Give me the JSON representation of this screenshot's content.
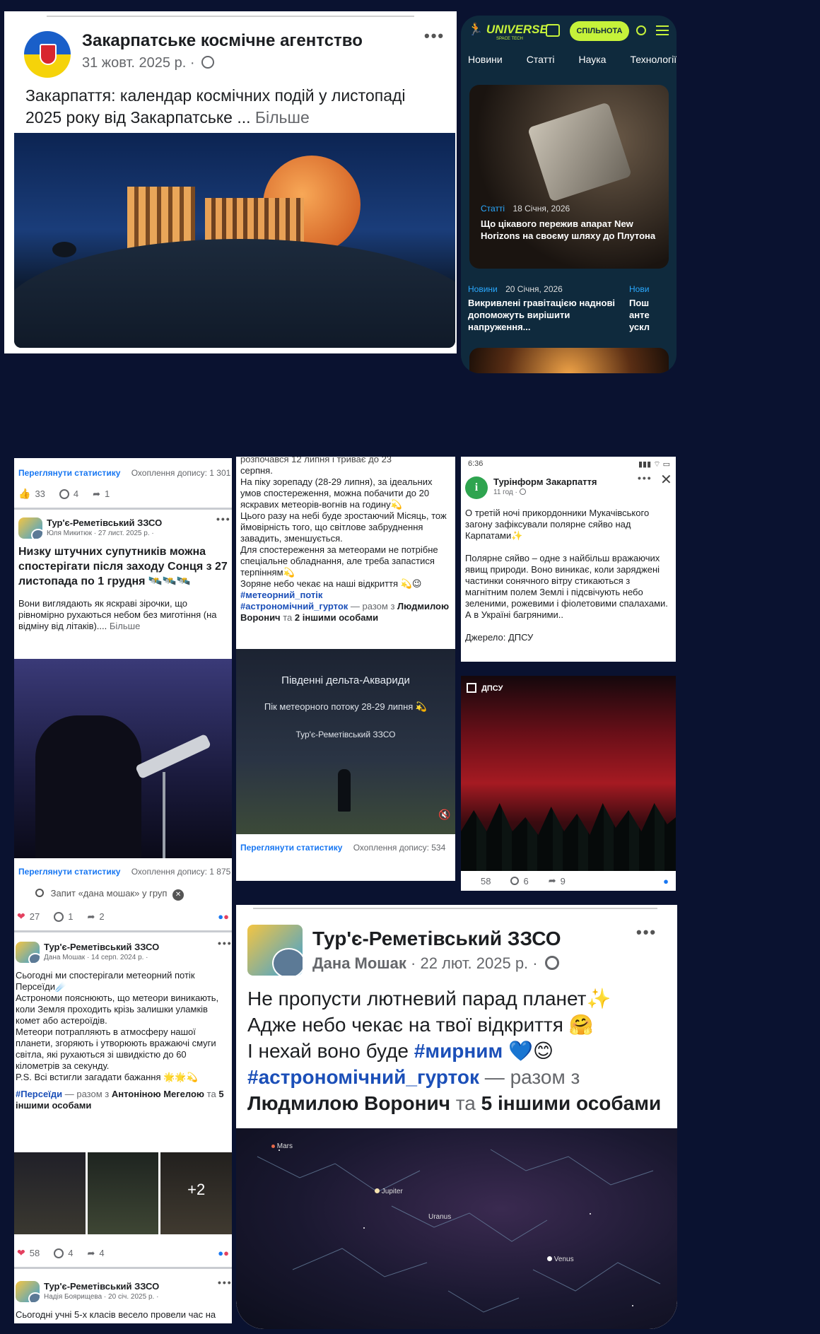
{
  "post1": {
    "page_name": "Закарпатське космічне агентство",
    "date": "31 жовт. 2025 р. ·",
    "text": "Закарпаття: календар космічних подій у листопаді 2025 року від Закарпатське ...",
    "more": "Більше",
    "menu": "•••"
  },
  "universe": {
    "logo": "UNIVERSE",
    "logo_sub": "SPACE TECH",
    "community_btn": "СПІЛЬНОТА",
    "nav": [
      "Новини",
      "Статті",
      "Наука",
      "Технології"
    ],
    "article1": {
      "category": "Статті",
      "date": "18 Січня, 2026",
      "title": "Що цікавого пережив апарат New Horizons на своєму шляху до Плутона"
    },
    "article2": {
      "category": "Новини",
      "date": "20 Січня, 2026",
      "title": "Викривлені гравітацією наднові допоможуть вирішити напруження..."
    },
    "article3": {
      "category": "Нови",
      "title": "Пош анте ускл"
    }
  },
  "post2": {
    "stats_link": "Переглянути статистику",
    "reach": "Охоплення допису: 1 301",
    "likes": "33",
    "comments": "4",
    "shares": "1",
    "page_name": "Тур'є-Реметівський ЗЗСО",
    "author_date": "Юля Микитюк · 27 лист. 2025 р. ·",
    "headline": "Низку штучних супутників можна спостерігати після заходу Сонця з 27 листопада по 1 грудня 🛰️🛰️🛰️",
    "body": "Вони виглядають як яскраві зірочки, що рівномірно рухаються небом без миготіння (на відміну від літаків)....",
    "more": "Більше",
    "stats_link2": "Переглянути статистику",
    "reach2": "Охоплення допису: 1 875"
  },
  "post3": {
    "lines": [
      "розпочався 12 липня і триває до 23",
      "серпня.",
      "На піку зорепаду (28-29 липня), за ідеальних умов спостереження, можна побачити до 20 яскравих метеорів-вогнів на годину💫",
      "Цього разу на небі буде зростаючий Місяць, тож ймовірність того, що світлове забруднення завадить, зменшується.",
      "Для спостереження за метеорами не потрібне спеціальне обладнання, але треба запастися терпінням💫",
      "Зоряне небо чекає на наші відкриття 💫😉"
    ],
    "tag1": "#метеорний_потік",
    "tag2": "#астрономічний_гурток",
    "with_text": "— разом з",
    "person": "Людмилою Воронич",
    "and_text": "та",
    "others": "2 іншими особами",
    "image_title": "Південні дельта-Аквариди",
    "image_sub": "Пік метеорного потоку 28-29 липня 💫",
    "image_school": "Тур'є-Реметівський ЗЗСО",
    "stats_link": "Переглянути статистику",
    "reach": "Охоплення допису: 534"
  },
  "post4": {
    "time": "6:36",
    "page_name": "Турінформ Закарпаття",
    "meta": "11 год ·",
    "p1": "О третій ночі прикордонники Мукачівського загону зафіксували полярне сяйво над Карпатами✨",
    "p2": "Полярне сяйво – одне з найбільш вражаючих явищ природи. Воно виникає, коли заряджені частинки сонячного вітру стикаються з магнітним полем Землі і підсвічують небо зеленими, рожевими і фіолетовими спалахами. А в Україні багряними..",
    "source": "Джерело: ДПСУ",
    "image_badge": "ДПСУ",
    "likes": "58",
    "comments": "6",
    "shares": "9"
  },
  "post5": {
    "search": "Запит «дана мошак» у груп",
    "likes": "27",
    "comments": "1",
    "shares": "2",
    "page_name": "Тур'є-Реметівський ЗЗСО",
    "author_date": "Дана Мошак · 14 серп. 2024 р. ·",
    "body": "Сьогодні ми спостерігали метеорний потік Персеїди☄️\nАстрономи пояснюють, що метеори виникають, коли Земля проходить крізь залишки уламків комет або астероїдів.\nМетеори потрапляють в атмосферу нашої планети, згоряють і утворюють вражаючі смуги світла, які рухаються зі швидкістю до 60 кілометрів за секунду.\nP.S. Всі встигли загадати бажання 🌟🌟💫",
    "tag": "#Персеїди",
    "with_text": "— разом з",
    "person": "Антоніною Мегелою",
    "and_text": "та",
    "others": "5 іншими особами",
    "more_photos": "+2",
    "likes2": "58",
    "comments2": "4",
    "shares2": "4"
  },
  "post6": {
    "page_name": "Тур'є-Реметівський ЗЗСО",
    "author_date": "Надія Боярищева · 20 січ. 2025 р. ·",
    "body": "Сьогодні учні 5-х класів весело провели час на"
  },
  "post7": {
    "page_name": "Тур'є-Реметівський ЗЗСО",
    "author": "Дана Мошак",
    "date": "· 22 лют. 2025 р. ·",
    "line1": "Не пропусти лютневий парад планет✨",
    "line2": "Адже небо чекає на твої відкриття 🤗",
    "line3_pre": "І нехай воно буде",
    "line3_tag": "#мирним",
    "line3_emoji": "💙😊",
    "tag2": "#астрономічний_гурток",
    "with_text": "— разом з",
    "person": "Людмилою Воронич",
    "and_text": "та",
    "others": "5 іншими особами",
    "planets": [
      "Mars",
      "Jupiter",
      "Uranus",
      "Venus"
    ]
  },
  "colors": {
    "background": "#0a1230",
    "facebook_blue": "#1877f2",
    "universe_bg": "#0f2a3d",
    "universe_green": "#c6f23a"
  }
}
